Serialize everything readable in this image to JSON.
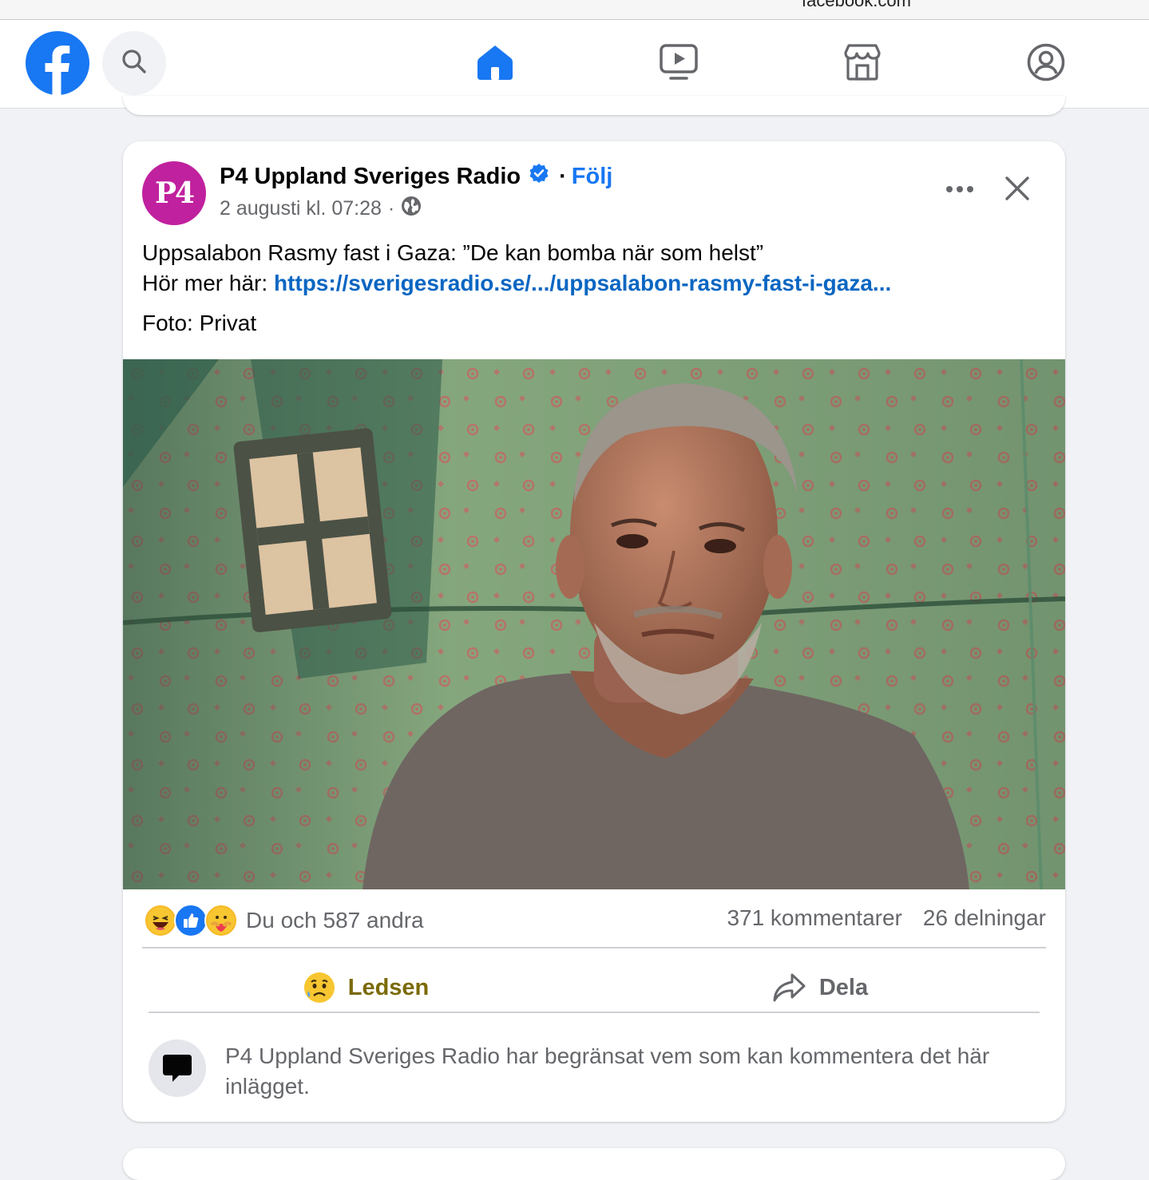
{
  "browser": {
    "url": "facebook.com"
  },
  "nav": {
    "tabs": [
      {
        "name": "home",
        "icon": "home-icon",
        "active": true
      },
      {
        "name": "watch",
        "icon": "video-icon",
        "active": false
      },
      {
        "name": "marketplace",
        "icon": "marketplace-icon",
        "active": false
      },
      {
        "name": "profile",
        "icon": "profile-icon",
        "active": false
      }
    ]
  },
  "post": {
    "avatar_text": "P4",
    "page_name": "P4 Uppland Sveriges Radio",
    "follow_label": "Följ",
    "dot": "·",
    "date": "2 augusti kl. 07:28",
    "date_sep": "·",
    "text_line1": "Uppsalabon Rasmy fast i Gaza: ”De kan bomba när som helst”",
    "text_line2_prefix": "Hör mer här: ",
    "link_text": "https://sverigesradio.se/.../uppsalabon-rasmy-fast-i-gaza...",
    "credit": "Foto: Privat",
    "reactions_text": "Du och 587 andra",
    "comments_count": "371 kommentarer",
    "shares_count": "26 delningar",
    "reaction_button_label": "Ledsen",
    "share_button_label": "Dela",
    "comment_restriction": "P4 Uppland Sveriges Radio har begränsat vem som kan kommentera det här inlägget."
  },
  "colors": {
    "brand": "#1877f2",
    "avatar_bg": "#c0219e",
    "sad_reaction": "#7b6a07",
    "secondary_text": "#65676b"
  }
}
